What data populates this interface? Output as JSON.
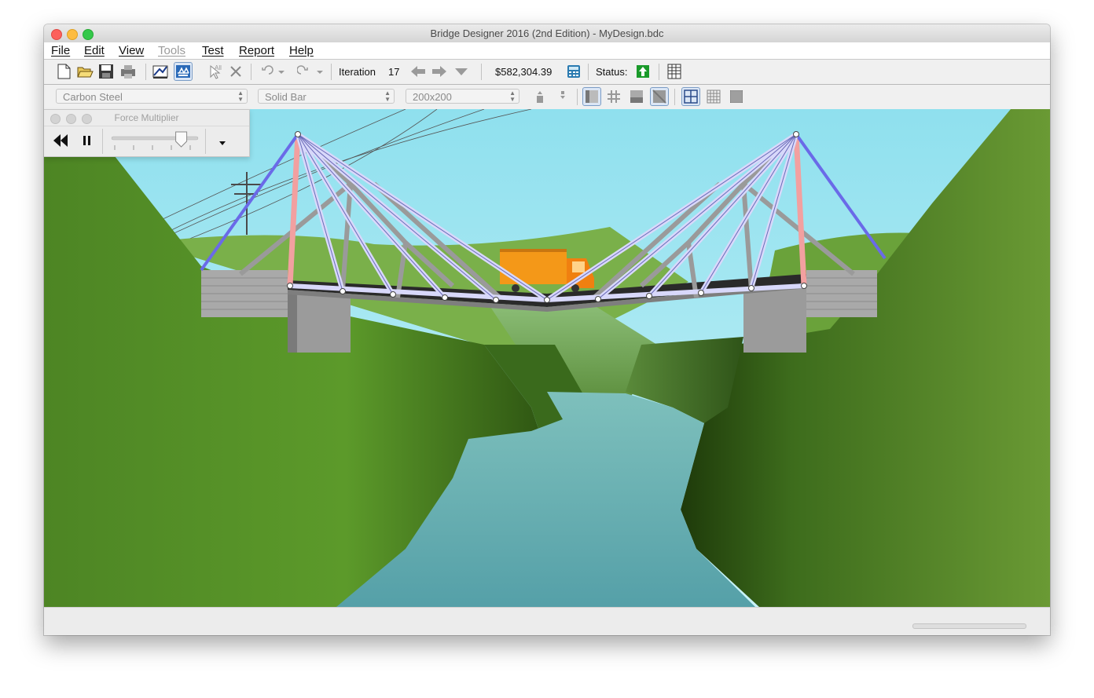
{
  "window": {
    "title": "Bridge Designer 2016 (2nd Edition) - MyDesign.bdc"
  },
  "menu": [
    {
      "label": "File",
      "enabled": true
    },
    {
      "label": "Edit",
      "enabled": true
    },
    {
      "label": "View",
      "enabled": true
    },
    {
      "label": "Tools",
      "enabled": false
    },
    {
      "label": "Test",
      "enabled": true
    },
    {
      "label": "Report",
      "enabled": true
    },
    {
      "label": "Help",
      "enabled": true
    }
  ],
  "toolbar": {
    "iteration_label": "Iteration",
    "iteration_value": "17",
    "cost": "$582,304.39",
    "status_label": "Status:",
    "status_color": "#1a9a2a",
    "icons": [
      "new-document-icon",
      "open-folder-icon",
      "save-icon",
      "print-icon",
      "drawing-board-icon",
      "load-test-icon",
      "select-all-icon",
      "delete-icon",
      "undo-icon",
      "redo-icon",
      "back-iteration-icon",
      "forward-iteration-icon",
      "iteration-dropdown-icon",
      "calculator-icon",
      "status-ok-icon",
      "report-table-icon"
    ]
  },
  "member_bar": {
    "material": "Carbon Steel",
    "section": "Solid Bar",
    "size": "200x200"
  },
  "force_palette": {
    "title": "Force Multiplier",
    "slider_level": 0.85
  },
  "colors": {
    "sky": "#a8e8f0",
    "water": "#5fa8ac",
    "terrain": "#4f8426",
    "compression": "#f2a0a0",
    "tension": "#6a6ae8",
    "truck_body": "#f49818"
  }
}
